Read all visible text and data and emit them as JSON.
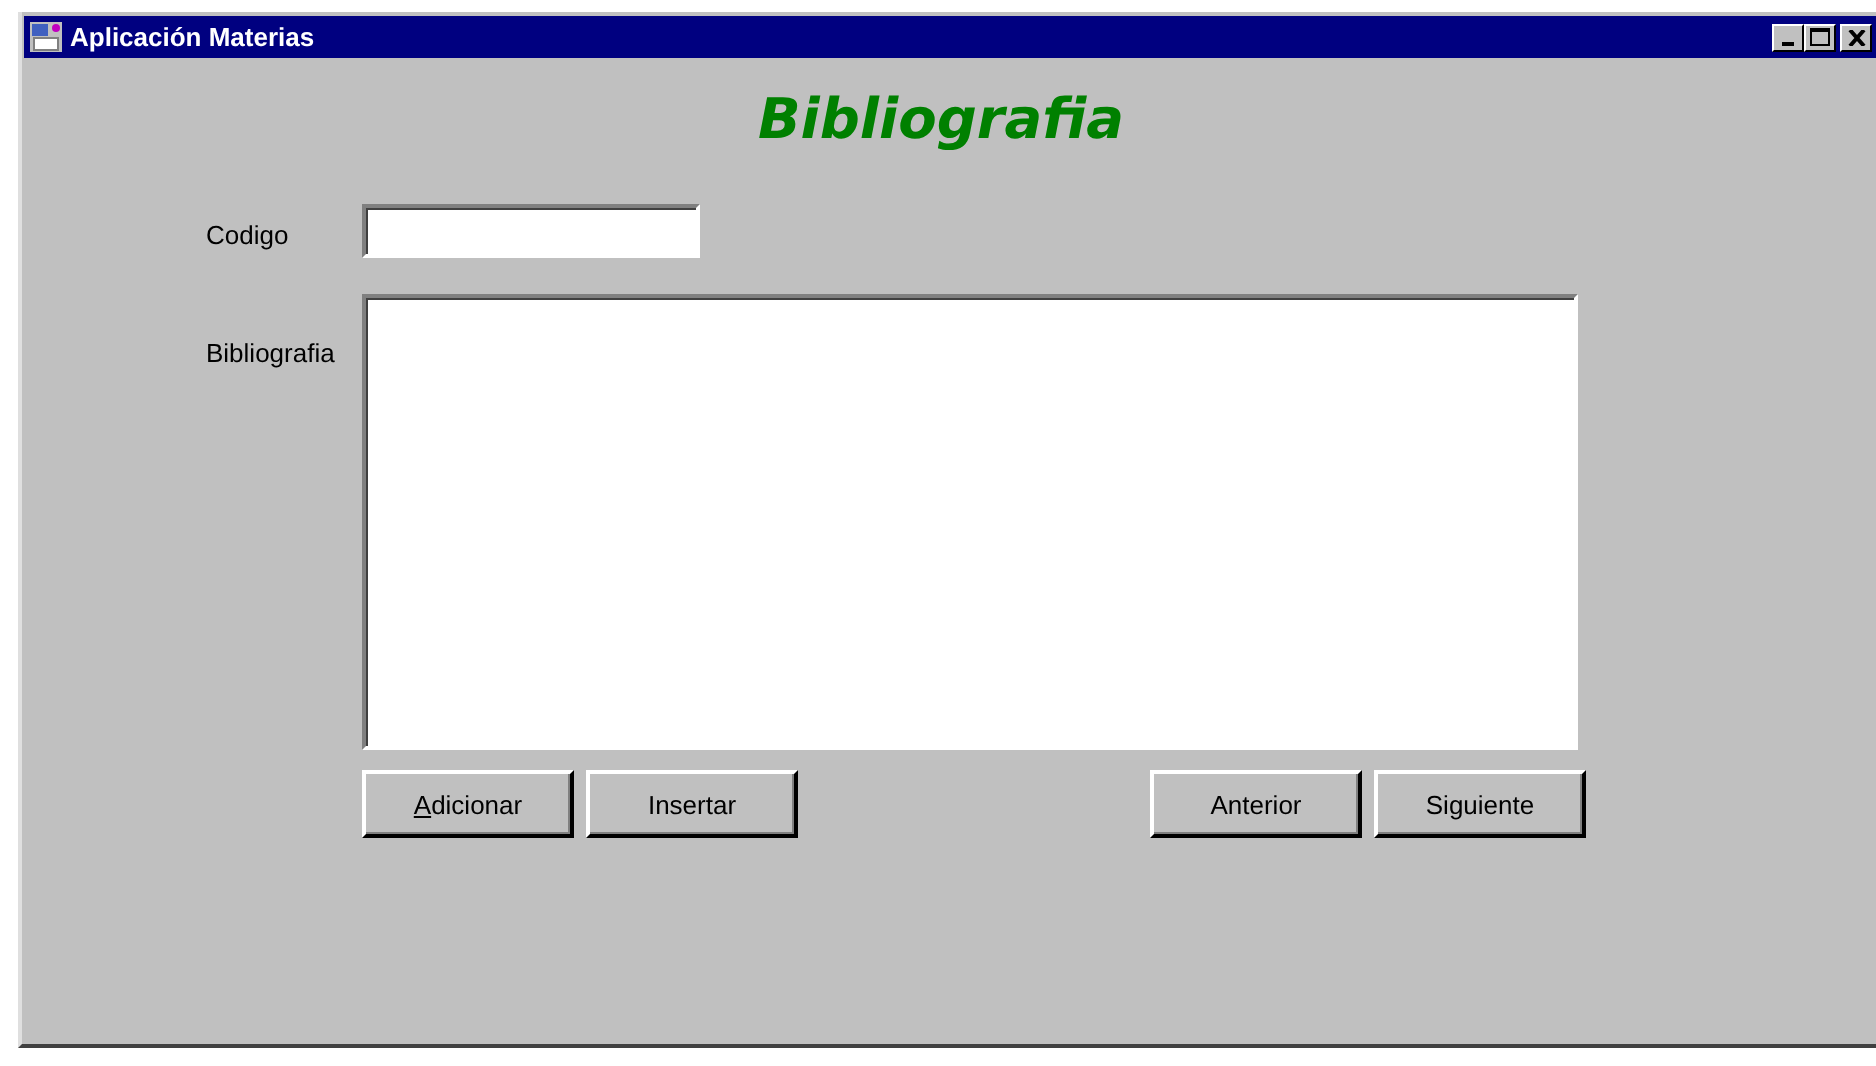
{
  "window": {
    "title": "Aplicación Materias"
  },
  "heading": "Bibliografia",
  "fields": [
    {
      "label": "Codigo",
      "kind": "input"
    },
    {
      "label": "Bibliografia",
      "kind": "textarea"
    }
  ],
  "buttons_left": [
    {
      "label": "Adicionar",
      "mnemonic": true
    },
    {
      "label": "Insertar",
      "mnemonic": false
    }
  ],
  "buttons_right": [
    {
      "label": "Anterior",
      "mnemonic": false
    },
    {
      "label": "Siguiente",
      "mnemonic": false
    }
  ]
}
